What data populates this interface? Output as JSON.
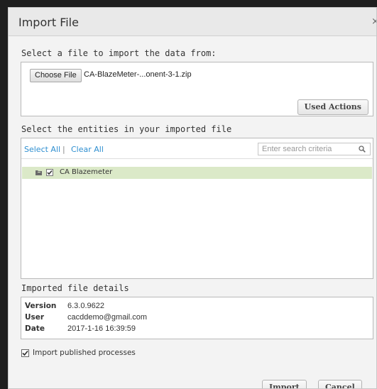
{
  "dialog": {
    "title": "Import File",
    "close_glyph": "×"
  },
  "file_section": {
    "label": "Select a file to import the data from:",
    "choose_button": "Choose File",
    "file_name": "CA-BlazeMeter-...onent-3-1.zip",
    "used_actions_button": "Used Actions"
  },
  "entities_section": {
    "label": "Select the entities in your imported file",
    "select_all": "Select All",
    "separator": "|",
    "clear_all": "Clear All",
    "search_placeholder": "Enter search criteria",
    "items": [
      {
        "label": "CA Blazemeter",
        "checked": true,
        "icon": "folder-icon"
      }
    ]
  },
  "details_section": {
    "label": "Imported file details",
    "rows": [
      {
        "key": "Version",
        "value": "6.3.0.9622"
      },
      {
        "key": "User",
        "value": "cacddemo@gmail.com"
      },
      {
        "key": "Date",
        "value": "2017-1-16 16:39:59"
      }
    ]
  },
  "options": {
    "import_published_label": "Import published processes",
    "import_published_checked": true
  },
  "footer": {
    "import_button": "Import",
    "cancel_button": "Cancel"
  },
  "colors": {
    "accent_link": "#2f8fd0",
    "selected_row": "#dbe9c8",
    "dialog_bg": "#f3f3f3",
    "backdrop": "#1f1f1f"
  }
}
